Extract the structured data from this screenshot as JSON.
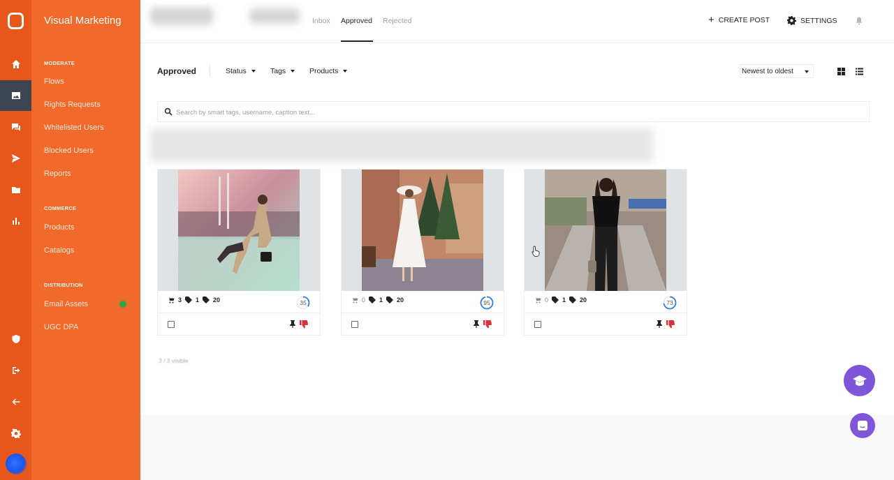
{
  "brand": "Visual Marketing",
  "sidebar": {
    "sections": [
      {
        "title": "MODERATE",
        "items": [
          "Flows",
          "Rights Requests",
          "Whitelisted Users",
          "Blocked Users",
          "Reports"
        ]
      },
      {
        "title": "COMMERCE",
        "items": [
          "Products",
          "Catalogs"
        ]
      },
      {
        "title": "DISTRIBUTION",
        "items": [
          "Email Assets",
          "UGC DPA"
        ]
      }
    ]
  },
  "topbar": {
    "tabs": [
      "Inbox",
      "Approved",
      "Rejected"
    ],
    "active_tab": "Approved",
    "create_label": "CREATE POST",
    "settings_label": "SETTINGS"
  },
  "filters": {
    "title": "Approved",
    "status": "Status",
    "tags": "Tags",
    "products": "Products",
    "sort": "Newest to oldest"
  },
  "search": {
    "placeholder": "Search by smart tags, username, caption text..."
  },
  "cards": [
    {
      "products": "3",
      "tags1": "1",
      "tags2": "20",
      "score": "35",
      "score_fraction": 0.35
    },
    {
      "products": "0",
      "tags1": "1",
      "tags2": "20",
      "score": "95",
      "score_fraction": 0.95
    },
    {
      "products": "0",
      "tags1": "1",
      "tags2": "20",
      "score": "73",
      "score_fraction": 0.73
    }
  ],
  "footer": {
    "visible_count": "3 / 3 visible"
  },
  "colors": {
    "rail": "#e8571a",
    "sidenav": "#f26a2b",
    "accent": "#7f56d9",
    "score_ring": "#2f7be5",
    "dislike": "#d8323c"
  }
}
